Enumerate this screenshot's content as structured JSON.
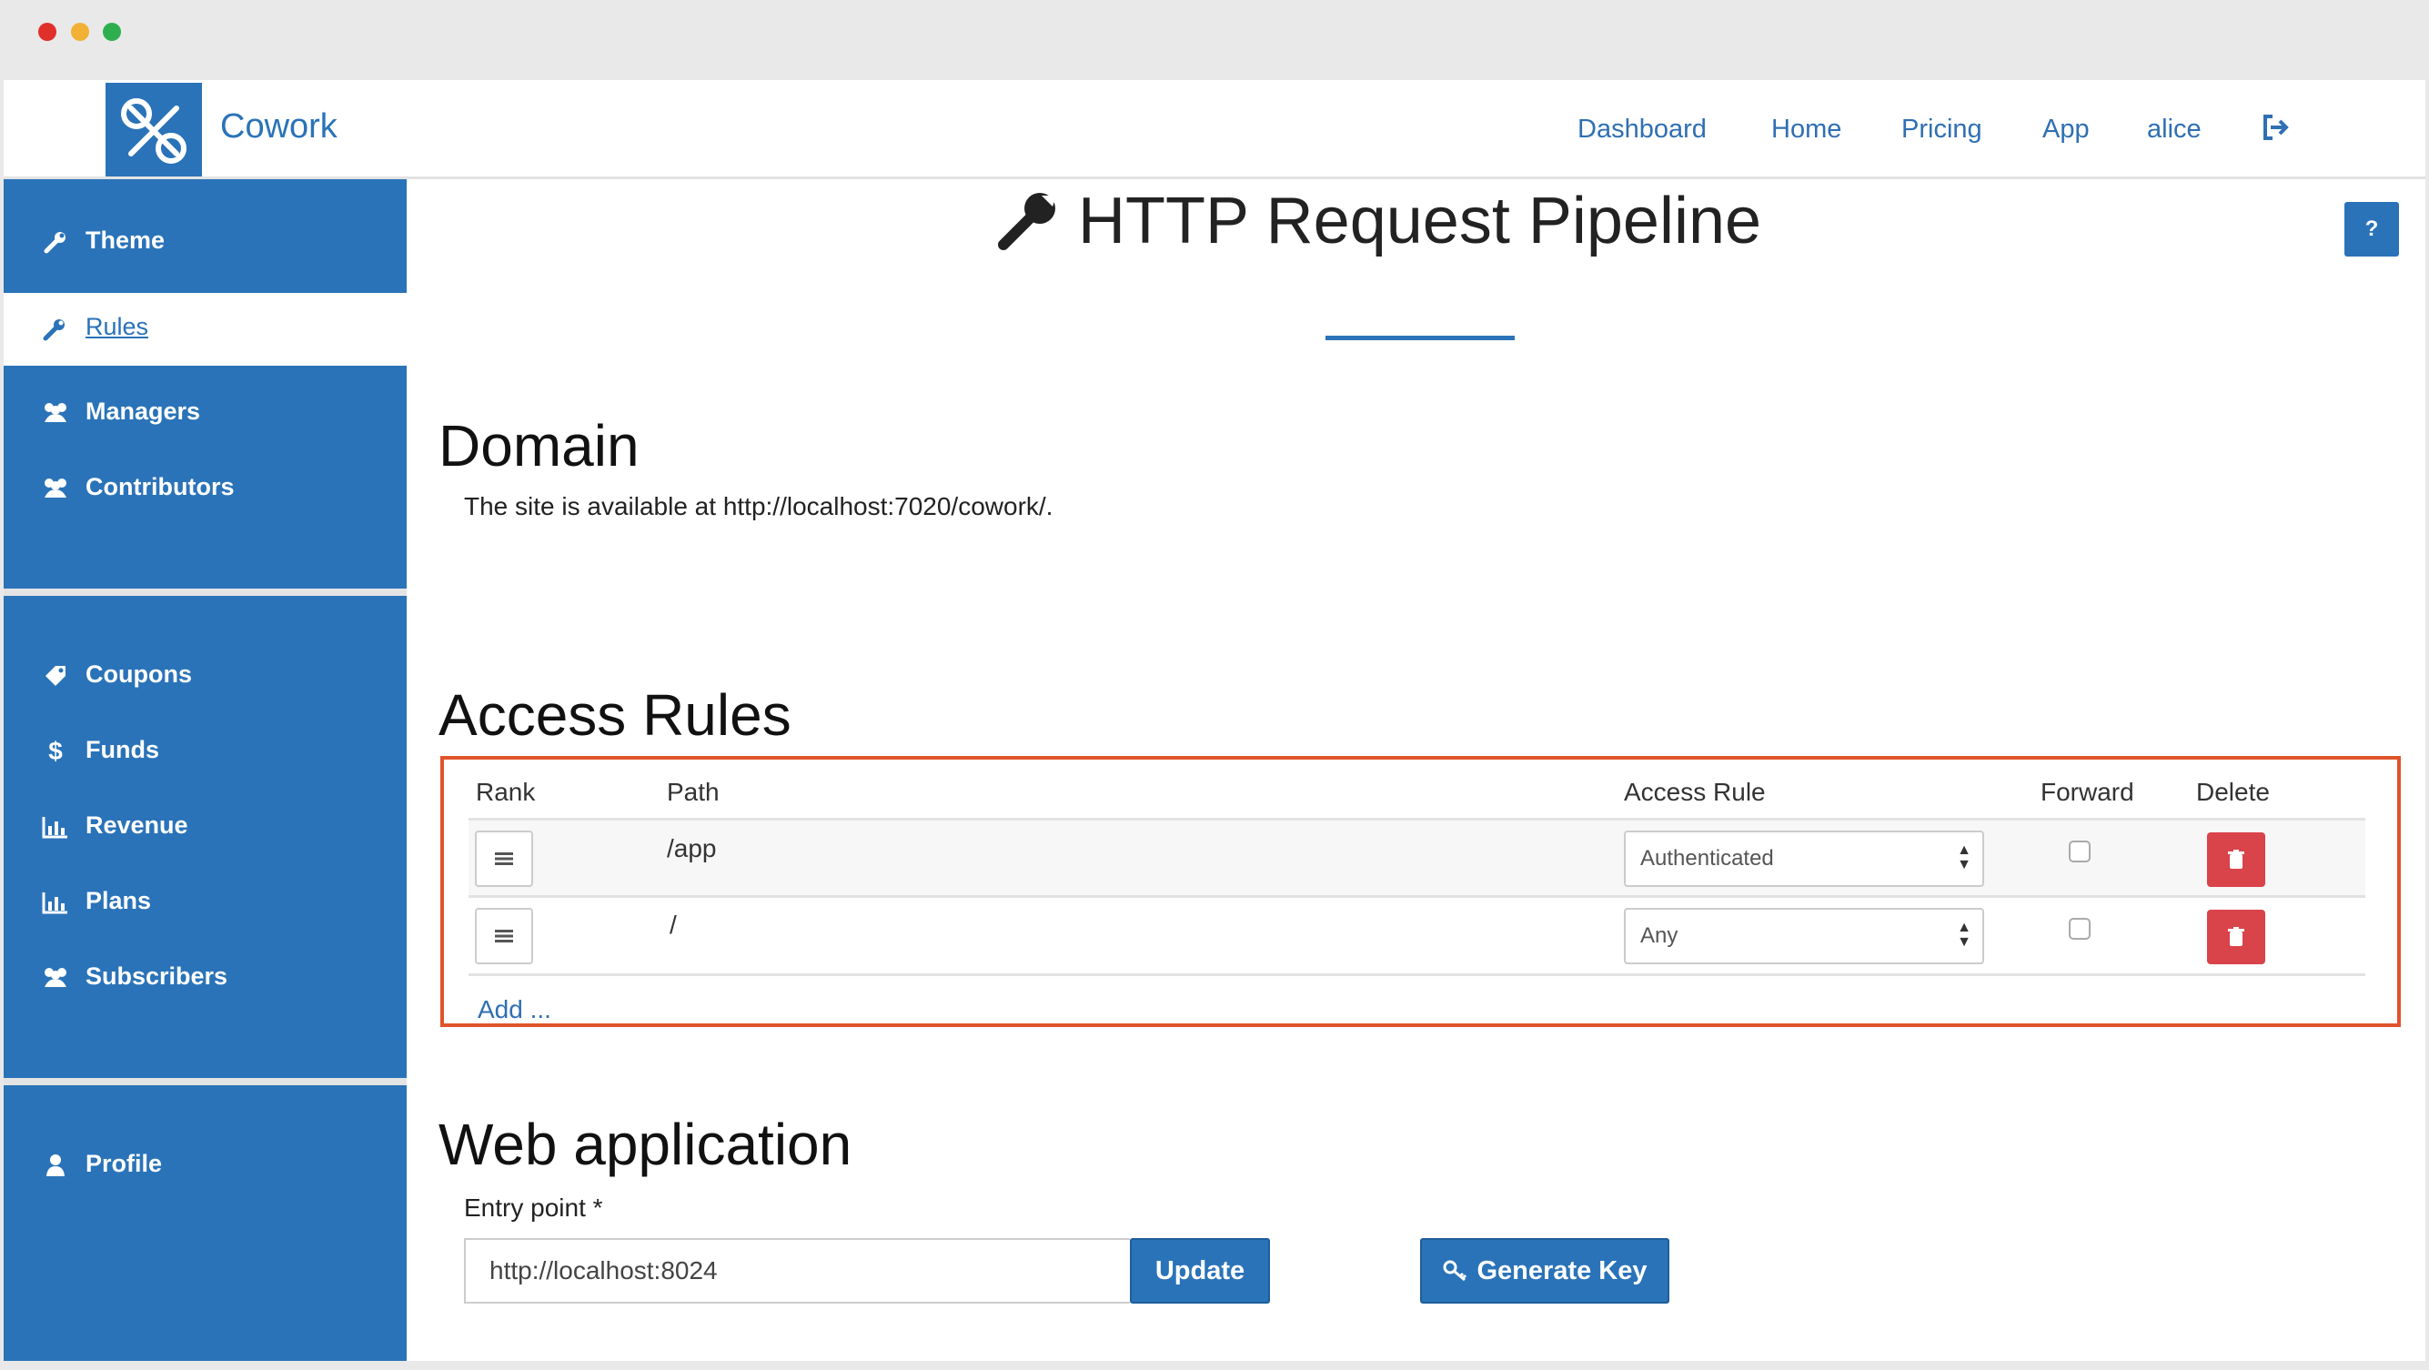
{
  "app": {
    "brand": "Cowork",
    "window_controls": [
      "close",
      "minimize",
      "maximize"
    ]
  },
  "topnav": {
    "links": [
      "Dashboard",
      "Home",
      "Pricing",
      "App",
      "alice"
    ],
    "logout_icon": "sign-out-icon"
  },
  "sidebar": {
    "items": [
      {
        "label": "Theme",
        "icon": "wrench-icon"
      },
      {
        "label": "Rules",
        "icon": "wrench-icon",
        "active": true
      },
      {
        "label": "Managers",
        "icon": "users-icon"
      },
      {
        "label": "Contributors",
        "icon": "users-icon"
      },
      {
        "label": "Coupons",
        "icon": "tag-icon"
      },
      {
        "label": "Funds",
        "icon": "dollar-icon"
      },
      {
        "label": "Revenue",
        "icon": "bar-chart-icon"
      },
      {
        "label": "Plans",
        "icon": "bar-chart-icon"
      },
      {
        "label": "Subscribers",
        "icon": "users-icon"
      },
      {
        "label": "Profile",
        "icon": "user-icon"
      }
    ]
  },
  "page": {
    "title": "HTTP Request Pipeline",
    "help_label": "?"
  },
  "domain": {
    "heading": "Domain",
    "text": "The site is available at http://localhost:7020/cowork/."
  },
  "access_rules": {
    "heading": "Access Rules",
    "columns": [
      "Rank",
      "Path",
      "Access Rule",
      "Forward",
      "Delete"
    ],
    "rows": [
      {
        "path": "/app",
        "access_rule": "Authenticated",
        "forward": false
      },
      {
        "path": "/",
        "access_rule": "Any",
        "forward": false
      }
    ],
    "add_label": "Add ..."
  },
  "web_application": {
    "heading": "Web application",
    "entry_label": "Entry point *",
    "entry_value": "http://localhost:8024",
    "update_label": "Update",
    "generate_label": "Generate Key"
  },
  "colors": {
    "primary": "#2a73b8",
    "danger": "#d9434a",
    "highlight_border": "#e0542b"
  }
}
